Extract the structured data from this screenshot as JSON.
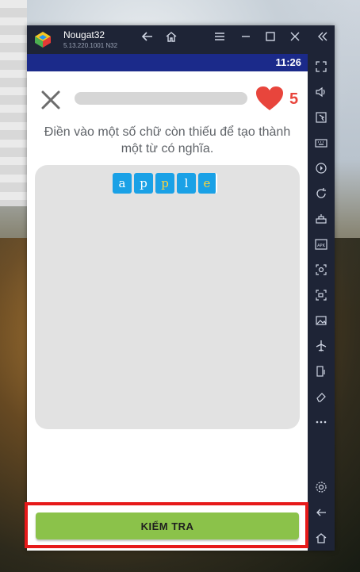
{
  "window": {
    "app_name": "Nougat32",
    "app_version": "5.13.220.1001  N32",
    "clock": "11:26"
  },
  "quiz": {
    "instruction": "Điền vào một số chữ còn thiếu để tạo thành một từ có nghĩa.",
    "lives": "5",
    "progress_fraction": 0,
    "tiles": [
      {
        "char": "a",
        "state": "given"
      },
      {
        "char": "p",
        "state": "given"
      },
      {
        "char": "p",
        "state": "filled"
      },
      {
        "char": "l",
        "state": "given"
      },
      {
        "char": "e",
        "state": "filled"
      }
    ],
    "check_button": "KIỂM TRA"
  },
  "colors": {
    "tile_bg": "#1aa1e6",
    "heart": "#e8453c",
    "check_button_bg": "#8bc24a",
    "status_bar": "#1b2a8a",
    "highlight_border": "#e61919"
  },
  "icons": {
    "rail": [
      "fullscreen-icon",
      "volume-icon",
      "pointer-icon",
      "keyboard-icon",
      "macro-icon",
      "rotate-icon",
      "multi-instance-icon",
      "apk-icon",
      "screenshot-icon",
      "record-icon",
      "gallery-icon",
      "airplane-icon",
      "shake-icon",
      "eraser-icon",
      "more-icon",
      "settings-icon",
      "back-icon",
      "home-icon",
      "recents-icon"
    ]
  }
}
